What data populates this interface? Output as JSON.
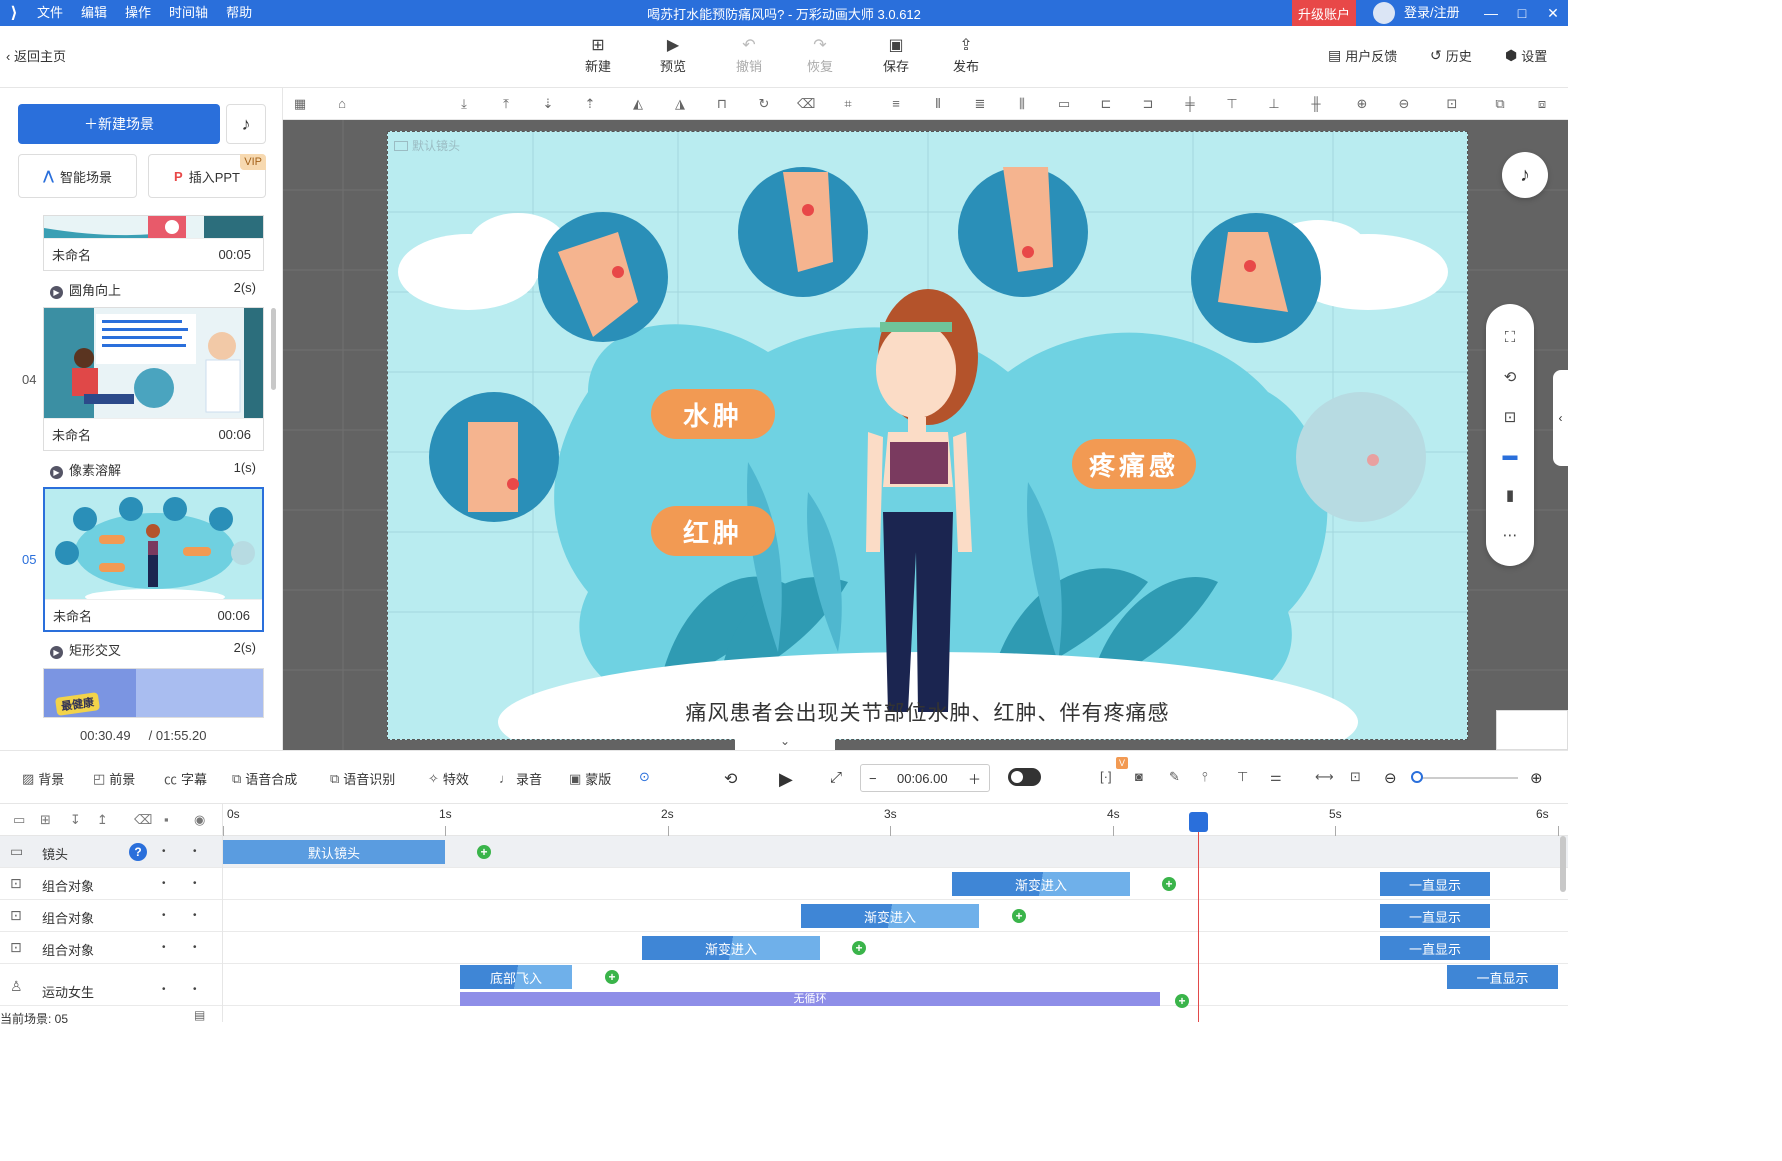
{
  "titlebar": {
    "menu": [
      "文件",
      "编辑",
      "操作",
      "时间轴",
      "帮助"
    ],
    "title": "喝苏打水能预防痛风吗? - 万彩动画大师 3.0.612",
    "upgrade": "升级账户",
    "login": "登录/注册",
    "win_min": "—",
    "win_max": "□",
    "win_close": "✕"
  },
  "maintoolbar": {
    "back": "返回主页",
    "new": "新建",
    "preview": "预览",
    "undo": "撤销",
    "redo": "恢复",
    "save": "保存",
    "publish": "发布",
    "feedback": "用户反馈",
    "history": "历史",
    "settings": "设置"
  },
  "leftpanel": {
    "new_scene": "新建场景",
    "smart_scene": "智能场景",
    "insert_ppt": "插入PPT",
    "vip": "VIP",
    "scenes": [
      {
        "num": "",
        "name": "未命名",
        "duration": "00:05"
      },
      {
        "num": "04",
        "name": "未命名",
        "duration": "00:06"
      },
      {
        "num": "05",
        "name": "未命名",
        "duration": "00:06"
      }
    ],
    "transitions": [
      {
        "name": "圆角向上",
        "time": "2(s)"
      },
      {
        "name": "像素溶解",
        "time": "1(s)"
      },
      {
        "name": "矩形交叉",
        "time": "2(s)"
      }
    ],
    "partial_thumb_text": "最健康",
    "current_time": "00:30.49",
    "total_time": "/ 01:55.20"
  },
  "stage": {
    "camera_label": "默认镜头",
    "labels": {
      "swelling": "水肿",
      "redness": "红肿",
      "pain": "疼痛感"
    },
    "subtitle": "痛风患者会出现关节部位水肿、红肿、伴有疼痛感"
  },
  "bottomtoolbar": {
    "background": "背景",
    "foreground": "前景",
    "caption": "字幕",
    "tts": "语音合成",
    "asr": "语音识别",
    "effects": "特效",
    "record": "录音",
    "mask": "蒙版",
    "time_value": "00:06.00",
    "v_badge": "V"
  },
  "timeline": {
    "ticks": [
      "0s",
      "1s",
      "2s",
      "3s",
      "4s",
      "5s",
      "6s"
    ],
    "tracks": [
      {
        "name": "镜头",
        "clips": [
          "默认镜头"
        ]
      },
      {
        "name": "组合对象",
        "clips": [
          "渐变进入",
          "一直显示"
        ]
      },
      {
        "name": "组合对象",
        "clips": [
          "渐变进入",
          "一直显示"
        ]
      },
      {
        "name": "组合对象",
        "clips": [
          "渐变进入",
          "一直显示"
        ]
      },
      {
        "name": "运动女生",
        "clips": [
          "底部飞入",
          "一直显示"
        ]
      }
    ],
    "partial_clip": "无循环",
    "footer": "当前场景: 05"
  },
  "colors": {
    "brand": "#2a6fdb",
    "upgrade": "#e84848",
    "label_orange": "#f29a53",
    "keyframe": "#3ab44a",
    "playhead": "#e24a4a"
  }
}
